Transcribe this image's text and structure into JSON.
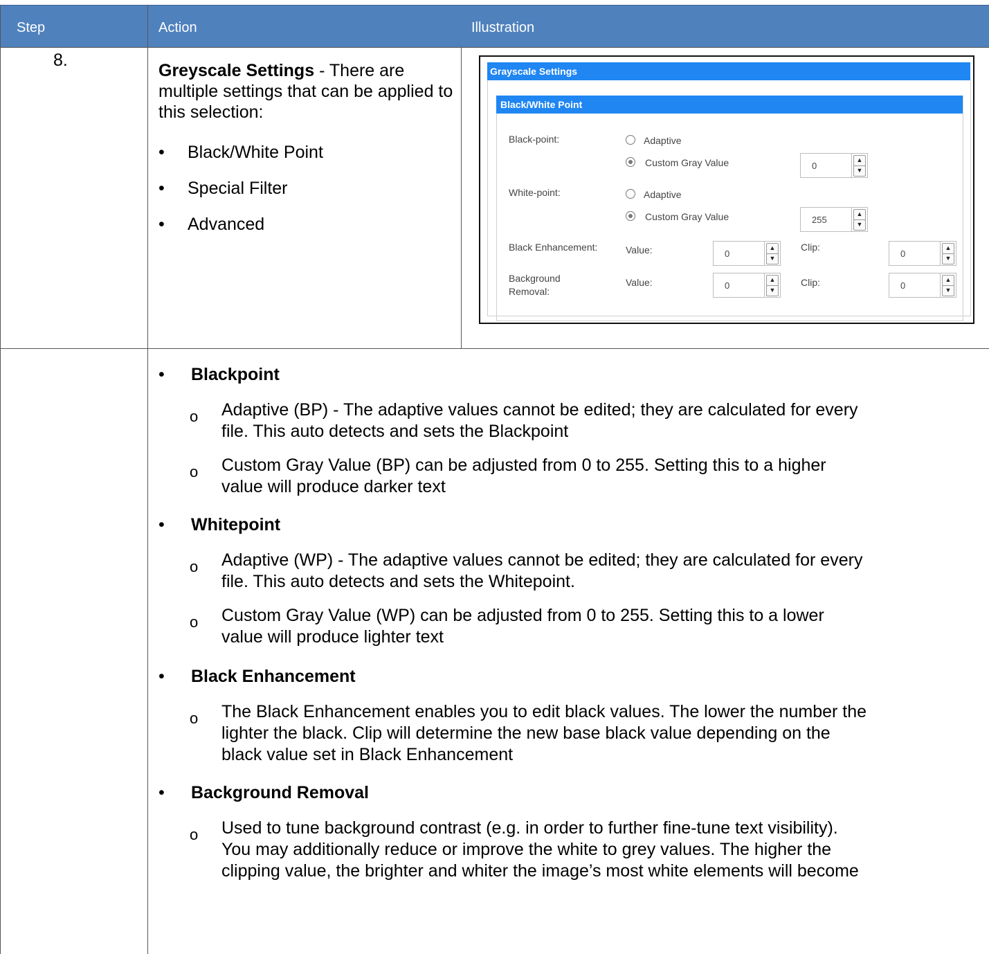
{
  "table": {
    "headers": [
      "Step",
      "Action",
      "Illustration"
    ],
    "row1": {
      "step": "8.",
      "action_bold": "Greyscale Settings",
      "action_text": " - There are multiple settings that can be applied to this selection:",
      "bullets": [
        "Black/White Point",
        "Special Filter",
        "Advanced"
      ]
    }
  },
  "illustration": {
    "title": "Grayscale Settings",
    "section_title": "Black/White Point",
    "black_point_label": "Black-point:",
    "white_point_label": "White-point:",
    "adaptive_label": "Adaptive",
    "custom_label": "Custom Gray Value",
    "black_point_value": "0",
    "white_point_value": "255",
    "black_enhancement_label": "Black Enhancement:",
    "background_removal_label_1": "Background",
    "background_removal_label_2": "Removal:",
    "value_label": "Value:",
    "clip_label": "Clip:",
    "be_value": "0",
    "be_clip": "0",
    "br_value": "0",
    "br_clip": "0",
    "black_point_mode": "Custom Gray Value",
    "white_point_mode": "Custom Gray Value",
    "accent_color": "#1f86f2",
    "header_color": "#4f81bd"
  },
  "details": [
    {
      "heading": "Blackpoint",
      "items": [
        [
          "Adaptive (BP) - The adaptive values cannot be edited; they are calculated for every",
          "file. This auto detects and sets the Blackpoint"
        ],
        [
          "Custom Gray Value (BP) can be adjusted from 0 to 255. Setting this to a higher",
          "value will produce darker text"
        ]
      ]
    },
    {
      "heading": "Whitepoint",
      "items": [
        [
          "Adaptive (WP) - The adaptive values cannot be edited; they are calculated for every",
          "file. This auto detects and sets the Whitepoint."
        ],
        [
          "Custom Gray Value (WP) can be adjusted from 0 to 255.  Setting this to a lower",
          "value will produce lighter text"
        ]
      ]
    },
    {
      "heading": "Black Enhancement",
      "items": [
        [
          "The Black Enhancement enables you to edit black values. The lower the number the",
          "lighter the black. Clip will determine the new base black value depending on the",
          "black value set in Black Enhancement"
        ]
      ]
    },
    {
      "heading": "Background Removal",
      "items": [
        [
          "Used to tune background contrast (e.g. in order to further fine-tune text visibility).",
          "You may additionally reduce or improve the white to grey values. The higher the",
          "clipping value, the brighter and whiter the image’s most white elements will become"
        ]
      ]
    }
  ]
}
